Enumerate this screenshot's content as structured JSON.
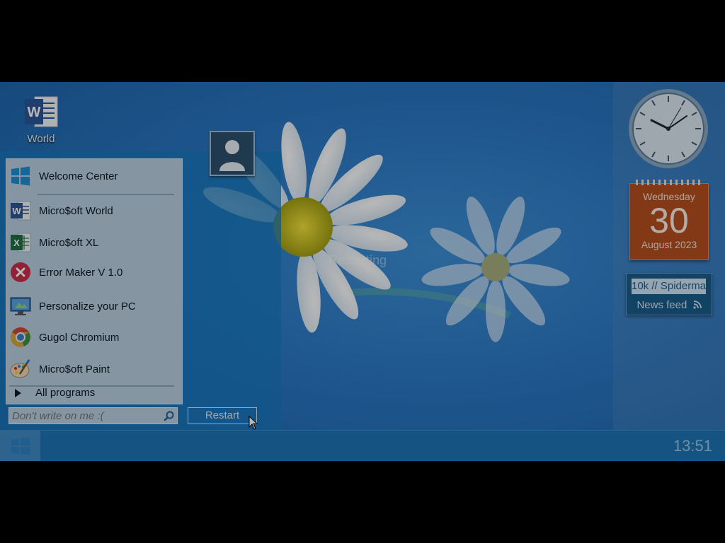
{
  "desktop": {
    "icons": [
      {
        "label": "World",
        "icon": "word-doc-icon"
      }
    ]
  },
  "gadgets": {
    "clock": {
      "hour": 10,
      "minute": 7,
      "second": 13
    },
    "calendar": {
      "weekday": "Wednesday",
      "day": "30",
      "month_year": "August 2023"
    },
    "news": {
      "ticker": "10k // Spiderma",
      "label": "News feed",
      "icon": "rss-icon"
    }
  },
  "start_menu": {
    "items": [
      {
        "label": "Welcome Center",
        "icon": "windows-logo-icon"
      },
      {
        "label": "Micro$oft World",
        "icon": "word-icon"
      },
      {
        "label": "Micro$oft XL",
        "icon": "excel-icon"
      },
      {
        "label": "Error Maker V 1.0",
        "icon": "error-icon"
      },
      {
        "label": "Personalize your PC",
        "icon": "monitor-icon"
      },
      {
        "label": "Gugol Chromium",
        "icon": "chromium-icon"
      },
      {
        "label": "Micro$oft Paint",
        "icon": "paint-icon"
      }
    ],
    "all_programs": "All programs",
    "search_placeholder": "Don't write on me :(",
    "restart_label": "Restart",
    "status_text": "Restarting"
  },
  "taskbar": {
    "time": "13:51"
  },
  "colors": {
    "taskbar": "#1d74b4",
    "start_panel": "#1878be",
    "calendar": "#b8501f",
    "news_gadget": "#1a5d8d"
  }
}
